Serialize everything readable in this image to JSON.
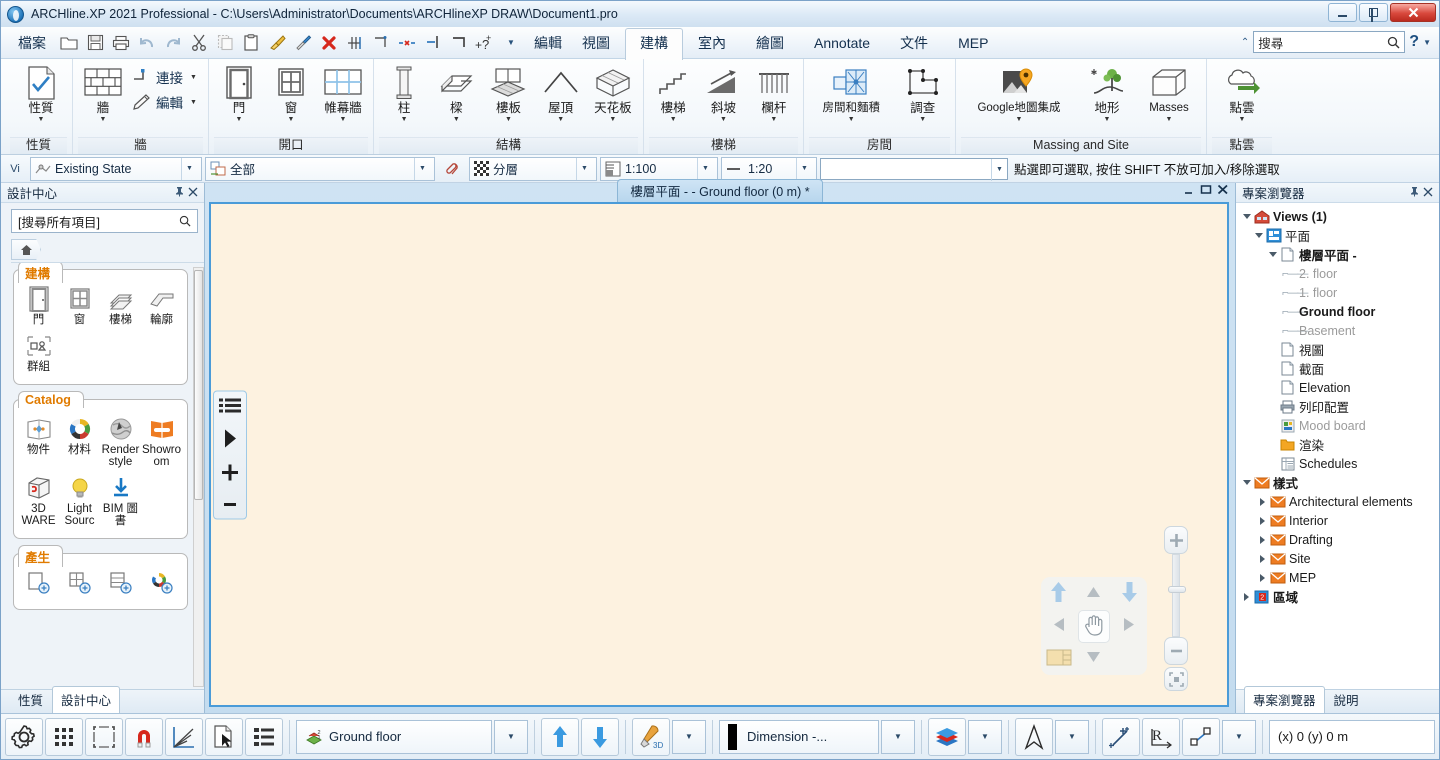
{
  "window": {
    "title": "ARCHline.XP 2021  Professional - C:\\Users\\Administrator\\Documents\\ARCHlineXP DRAW\\Document1.pro",
    "minimize": "–",
    "maximize": "□",
    "close": "✕"
  },
  "quickaccess": {
    "file_menu": "檔案",
    "edit_menu": "編輯",
    "view_menu": "視圖",
    "icons": [
      "open-folder-icon",
      "save-icon",
      "print-icon",
      "undo-icon",
      "redo-icon",
      "cut-icon",
      "copy-icon",
      "paste-icon",
      "paint-brush-icon",
      "eyedropper-icon",
      "delete-red-x-icon",
      "align-icon",
      "measure-icon",
      "dimension-delete-icon",
      "trim-icon",
      "corner-icon",
      "help-plus-icon"
    ]
  },
  "ribbon": {
    "tabs": [
      {
        "label": "建構",
        "active": true
      },
      {
        "label": "室內",
        "active": false
      },
      {
        "label": "繪圖",
        "active": false
      },
      {
        "label": "Annotate",
        "active": false
      },
      {
        "label": "文件",
        "active": false
      },
      {
        "label": "MEP",
        "active": false
      }
    ],
    "search": {
      "placeholder": "搜尋",
      "value": "搜尋",
      "icon": "search-icon"
    },
    "help": "?",
    "groups": [
      {
        "name": "性質",
        "buttons": [
          {
            "label": "性質",
            "icon": "properties-checkmark-icon",
            "dropdown": true
          }
        ]
      },
      {
        "name": "牆",
        "buttons": [
          {
            "label": "牆",
            "icon": "wall-brick-icon",
            "dropdown": true
          }
        ],
        "small_buttons": [
          {
            "label": "連接",
            "icon": "wall-connect-icon",
            "dropdown": true
          },
          {
            "label": "編輯",
            "icon": "pencil-edit-icon",
            "dropdown": true
          }
        ]
      },
      {
        "name": "開口",
        "buttons": [
          {
            "label": "門",
            "icon": "door-icon",
            "dropdown": true
          },
          {
            "label": "窗",
            "icon": "window-icon",
            "dropdown": true
          },
          {
            "label": "帷幕牆",
            "icon": "curtain-wall-icon",
            "dropdown": true
          }
        ]
      },
      {
        "name": "結構",
        "buttons": [
          {
            "label": "柱",
            "icon": "column-icon",
            "dropdown": true
          },
          {
            "label": "樑",
            "icon": "beam-icon",
            "dropdown": true
          },
          {
            "label": "樓板",
            "icon": "slab-icon",
            "dropdown": true
          },
          {
            "label": "屋頂",
            "icon": "roof-icon",
            "dropdown": true
          },
          {
            "label": "天花板",
            "icon": "ceiling-icon",
            "dropdown": true
          }
        ]
      },
      {
        "name": "樓梯",
        "buttons": [
          {
            "label": "樓梯",
            "icon": "stairs-icon",
            "dropdown": true
          },
          {
            "label": "斜坡",
            "icon": "ramp-icon",
            "dropdown": true
          },
          {
            "label": "欄杆",
            "icon": "railing-icon",
            "dropdown": true
          }
        ]
      },
      {
        "name": "房間",
        "buttons": [
          {
            "label": "房間和麵積",
            "icon": "room-area-icon",
            "dropdown": true
          },
          {
            "label": "調查",
            "icon": "survey-polyline-icon",
            "dropdown": true
          }
        ]
      },
      {
        "name": "Massing and Site",
        "buttons": [
          {
            "label": "Google地圖集成",
            "icon": "google-map-pin-icon",
            "dropdown": true
          },
          {
            "label": "地形",
            "icon": "terrain-tree-icon",
            "dropdown": true
          },
          {
            "label": "Masses",
            "icon": "mass-box-icon",
            "dropdown": true
          }
        ]
      },
      {
        "name": "點雲",
        "buttons": [
          {
            "label": "點雲",
            "icon": "point-cloud-icon",
            "dropdown": true
          }
        ]
      }
    ]
  },
  "optionsbar": {
    "vi_label": "Vi",
    "state": {
      "value": "Existing State",
      "icon": "existing-state-icon"
    },
    "filter": {
      "value": "全部",
      "icon": "all-layers-icon"
    },
    "link_icon": "link-paperclip-icon",
    "layer": {
      "value": "分層",
      "icon": "layer-checker-icon"
    },
    "scale_plan": {
      "value": "1:100",
      "icon": "scale-icon"
    },
    "scale_detail": {
      "value": "1:20",
      "icon": "line-icon"
    },
    "combo_empty": "",
    "hint": "點選即可選取, 按住 SHIFT 不放可加入/移除選取"
  },
  "design_center": {
    "title": "設計中心",
    "pin_icon": "pin-icon",
    "close_icon": "close-icon",
    "search_placeholder": "[搜尋所有項目]",
    "search_value": "[搜尋所有項目]",
    "search_icon": "search-icon",
    "home_icon": "home-icon",
    "groups": [
      {
        "title": "建構",
        "items": [
          {
            "label": "門",
            "icon": "door-icon"
          },
          {
            "label": "窗",
            "icon": "window-icon"
          },
          {
            "label": "樓梯",
            "icon": "stairs-icon"
          },
          {
            "label": "輪廓",
            "icon": "profile-icon"
          },
          {
            "label": "群組",
            "icon": "group-icon"
          }
        ]
      },
      {
        "title": "Catalog",
        "items": [
          {
            "label": "物件",
            "icon": "object-catalog-icon"
          },
          {
            "label": "材料",
            "icon": "material-wheel-icon"
          },
          {
            "label": "Render style",
            "icon": "render-style-icon"
          },
          {
            "label": "Showroom",
            "icon": "showroom-icon"
          },
          {
            "label": "3D WARE",
            "icon": "3d-warehouse-icon"
          },
          {
            "label": "Light Sourc",
            "icon": "light-source-icon"
          },
          {
            "label": "BIM 圖書",
            "icon": "bim-library-download-icon"
          }
        ]
      },
      {
        "title": "產生",
        "items": [
          {
            "label": "",
            "icon": "add-door-icon"
          },
          {
            "label": "",
            "icon": "add-window-icon"
          },
          {
            "label": "",
            "icon": "add-furniture-icon"
          },
          {
            "label": "",
            "icon": "add-material-icon"
          }
        ]
      }
    ],
    "tabs": [
      {
        "label": "性質",
        "active": false
      },
      {
        "label": "設計中心",
        "active": true
      }
    ]
  },
  "canvas": {
    "doc_tab": "樓層平面 -  - Ground floor (0 m) *",
    "doc_minimize": "–",
    "doc_restore": "❐",
    "doc_close": "✕",
    "left_toolbar": [
      {
        "icon": "list-menu-icon"
      },
      {
        "icon": "play-arrow-icon"
      },
      {
        "icon": "plus-icon"
      },
      {
        "icon": "minus-icon"
      }
    ],
    "navcube": {
      "up_icon": "arrow-up-blue-icon",
      "pan_up_icon": "arrow-up-gray-icon",
      "down_icon": "arrow-down-blue-icon",
      "left_icon": "arrow-left-gray-icon",
      "hand_icon": "pan-hand-icon",
      "right_icon": "arrow-right-gray-icon",
      "view_icon": "view-swatch-icon",
      "pan_down_icon": "arrow-down-gray-icon"
    },
    "zoom_slider": {
      "plus": "+",
      "minus": "–",
      "fit_icon": "zoom-fit-icon"
    }
  },
  "project_navigator": {
    "title": "專案瀏覽器",
    "pin_icon": "pin-icon",
    "close_icon": "close-icon",
    "nodes": [
      {
        "label": "Views (1)",
        "indent": 0,
        "twisty": "down",
        "icon": "views-house-icon",
        "bold": true,
        "dim": false
      },
      {
        "label": "平面",
        "indent": 1,
        "twisty": "down",
        "icon": "plan-icon",
        "bold": false,
        "dim": false
      },
      {
        "label": "樓層平面 -",
        "indent": 2,
        "twisty": "down",
        "icon": "page-icon",
        "bold": true,
        "dim": false
      },
      {
        "label": "2. floor",
        "indent": 3,
        "twisty": "dash",
        "icon": "",
        "bold": false,
        "dim": true
      },
      {
        "label": "1. floor",
        "indent": 3,
        "twisty": "dash",
        "icon": "",
        "bold": false,
        "dim": true
      },
      {
        "label": "Ground floor",
        "indent": 3,
        "twisty": "dash",
        "icon": "",
        "bold": true,
        "dim": false
      },
      {
        "label": "Basement",
        "indent": 3,
        "twisty": "dash",
        "icon": "",
        "bold": false,
        "dim": true
      },
      {
        "label": "視圖",
        "indent": 2,
        "twisty": "none",
        "icon": "page-icon",
        "bold": false,
        "dim": false
      },
      {
        "label": "截面",
        "indent": 2,
        "twisty": "none",
        "icon": "page-icon",
        "bold": false,
        "dim": false
      },
      {
        "label": "Elevation",
        "indent": 2,
        "twisty": "none",
        "icon": "page-icon",
        "bold": false,
        "dim": false
      },
      {
        "label": "列印配置",
        "indent": 2,
        "twisty": "none",
        "icon": "printer-icon",
        "bold": false,
        "dim": false
      },
      {
        "label": "Mood board",
        "indent": 2,
        "twisty": "none",
        "icon": "mood-board-icon",
        "bold": false,
        "dim": true
      },
      {
        "label": "渲染",
        "indent": 2,
        "twisty": "none",
        "icon": "folder-icon",
        "bold": false,
        "dim": false
      },
      {
        "label": "Schedules",
        "indent": 2,
        "twisty": "none",
        "icon": "schedules-icon",
        "bold": false,
        "dim": false
      },
      {
        "label": "樣式",
        "indent": 0,
        "twisty": "down",
        "icon": "styles-icon",
        "bold": true,
        "dim": false
      },
      {
        "label": "Architectural elements",
        "indent": 1,
        "twisty": "right",
        "icon": "styles-icon",
        "bold": false,
        "dim": false
      },
      {
        "label": "Interior",
        "indent": 1,
        "twisty": "right",
        "icon": "styles-icon",
        "bold": false,
        "dim": false
      },
      {
        "label": "Drafting",
        "indent": 1,
        "twisty": "right",
        "icon": "styles-icon",
        "bold": false,
        "dim": false
      },
      {
        "label": "Site",
        "indent": 1,
        "twisty": "right",
        "icon": "styles-icon",
        "bold": false,
        "dim": false
      },
      {
        "label": "MEP",
        "indent": 1,
        "twisty": "right",
        "icon": "styles-icon",
        "bold": false,
        "dim": false
      },
      {
        "label": "區域",
        "indent": 0,
        "twisty": "right",
        "icon": "zone-icon",
        "bold": true,
        "dim": false
      }
    ],
    "tabs": [
      {
        "label": "專案瀏覽器",
        "active": true
      },
      {
        "label": "說明",
        "active": false
      }
    ]
  },
  "statusbar": {
    "buttons": [
      {
        "icon": "settings-gear-icon"
      },
      {
        "icon": "grid-dots-icon"
      },
      {
        "icon": "bounding-box-icon"
      },
      {
        "icon": "magnet-snap-icon"
      },
      {
        "icon": "angle-snap-icon"
      },
      {
        "icon": "select-cursor-icon"
      },
      {
        "icon": "list-properties-icon"
      }
    ],
    "floor": {
      "value": "Ground floor",
      "icon": "floor-stack-icon"
    },
    "up_icon": "arrow-up-blue-icon",
    "down_icon": "arrow-down-blue-icon",
    "tool3d_icon": "hammer-3d-icon",
    "linetype_swatch": "#000000",
    "dimension": {
      "value": "Dimension -..."
    },
    "layers_icon": "layers-stack-icon",
    "north_icon": "north-arrow-icon",
    "snap_icon": "snap-point-icon",
    "radius_icon": "radius-icon",
    "polyline_icon": "polyline-node-icon",
    "coordinates": "(x) 0   (y) 0 m"
  }
}
